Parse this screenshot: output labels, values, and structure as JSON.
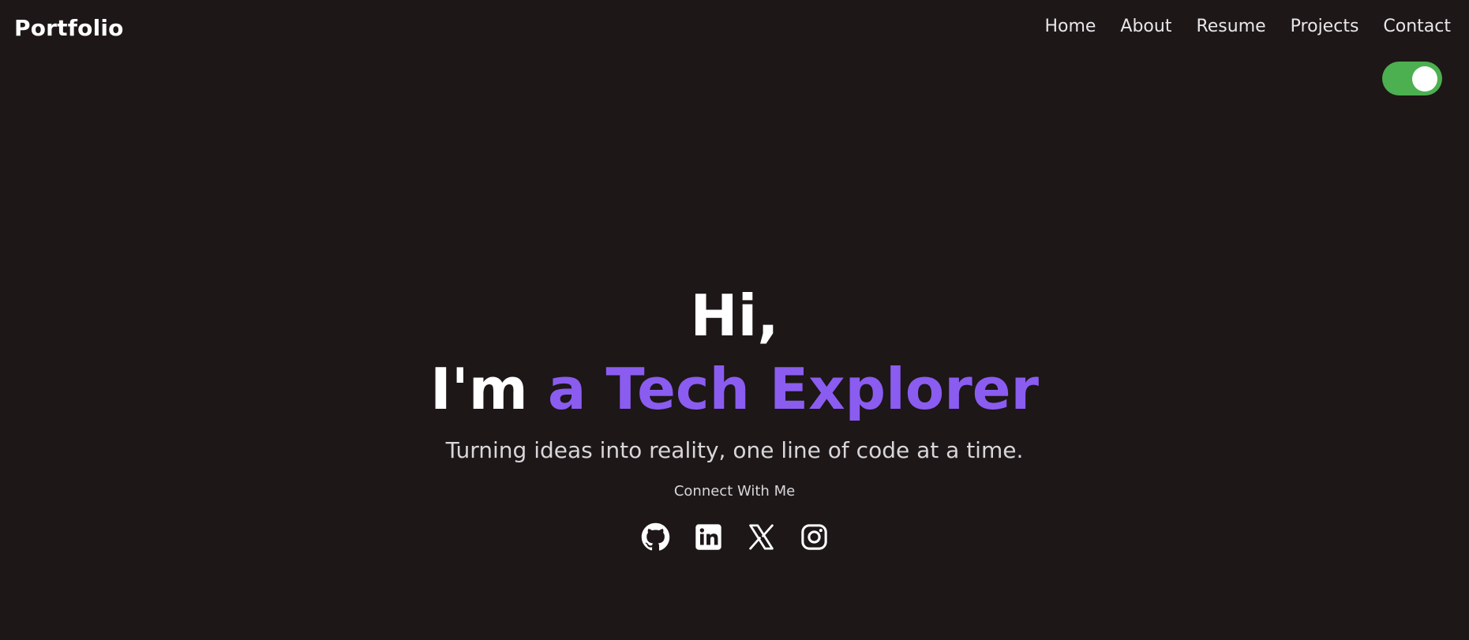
{
  "navbar": {
    "brand": "Portfolio",
    "links": [
      "Home",
      "About",
      "Resume",
      "Projects",
      "Contact"
    ]
  },
  "theme_toggle": {
    "state": "on",
    "color": "#4caf50"
  },
  "hero": {
    "greeting": "Hi,",
    "title_prefix": "I'm ",
    "title_highlight": "a Tech Explorer",
    "tagline": "Turning ideas into reality, one line of code at a time.",
    "connect_label": "Connect With Me"
  },
  "socials": [
    {
      "icon": "github-icon"
    },
    {
      "icon": "linkedin-icon"
    },
    {
      "icon": "x-icon"
    },
    {
      "icon": "instagram-icon"
    }
  ],
  "colors": {
    "background": "#1d1717",
    "accent": "#8b5cf0",
    "toggle": "#4caf50",
    "text": "#ffffff"
  }
}
